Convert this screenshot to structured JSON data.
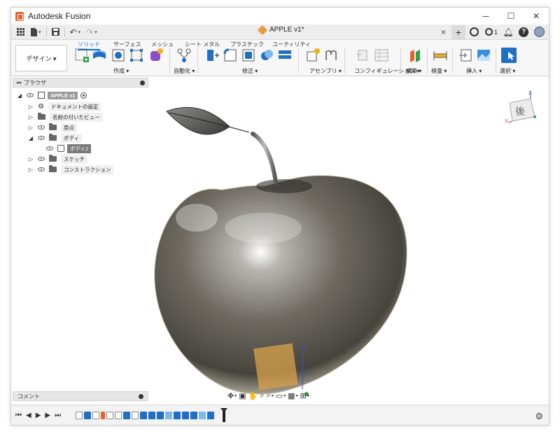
{
  "window": {
    "title": "Autodesk Fusion",
    "controls": [
      "─",
      "☐",
      "✕"
    ]
  },
  "tabstrip": {
    "document_tab": "APPLE v1*",
    "close": "×",
    "plus": "+",
    "job_count": "1",
    "help": "?"
  },
  "ribbon": {
    "workspace": "デザイン ▾",
    "tabs": [
      "ソリッド",
      "サーフェス",
      "メッシュ",
      "シート メタル",
      "プラスチック",
      "ユーティリティ"
    ],
    "groups": [
      "作成 ▾",
      "自動化 ▾",
      "修正 ▾",
      "アセンブリ ▾",
      "コンフィギュレーション ▾",
      "構築 ▾",
      "検査 ▾",
      "挿入 ▾",
      "選択 ▾"
    ]
  },
  "browser": {
    "title": "ブラウザ",
    "root": "APPLE v1",
    "items": [
      {
        "label": "ドキュメントの設定"
      },
      {
        "label": "名前の付いたビュー"
      },
      {
        "label": "原点"
      },
      {
        "label": "ボディ"
      },
      {
        "label": "ボディ2"
      },
      {
        "label": "スケッチ"
      },
      {
        "label": "コンストラクション"
      }
    ]
  },
  "viewcube": {
    "face": "後",
    "axis_z": "Z",
    "axis_x": "X"
  },
  "comments": {
    "label": "コメント"
  },
  "colors": {
    "accent": "#0a6fd6",
    "logo": "#e8632b",
    "apple": "#555048"
  }
}
